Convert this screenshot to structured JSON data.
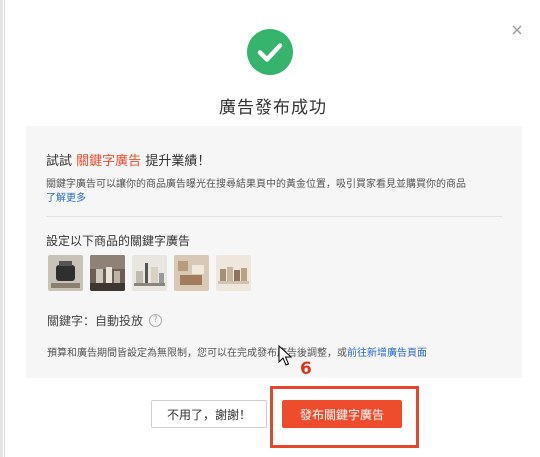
{
  "dialog": {
    "title": "廣告發布成功",
    "close_icon": "close-icon",
    "status_icon": "check-circle-icon",
    "colors": {
      "accent": "#ee4d2d",
      "success": "#36b36c",
      "link": "#2a6bd1"
    }
  },
  "promo": {
    "prefix": "試試",
    "highlight": "關鍵字廣告",
    "suffix": "提升業績！",
    "description": "關鍵字廣告可以讓你的商品廣告曝光在搜尋結果頁中的黃金位置，吸引買家看見並購買你的商品",
    "learn_more": "了解更多"
  },
  "products": {
    "label": "設定以下商品的關鍵字廣告",
    "thumbnails": [
      "product-1",
      "product-2",
      "product-3",
      "product-4",
      "product-5"
    ]
  },
  "keyword": {
    "label": "關鍵字：自動投放",
    "help_icon": "?"
  },
  "note": {
    "text": "預算和廣告期間皆設定為無限制，您可以在完成發布廣告後調整，或",
    "link": "前往新增廣告頁面"
  },
  "annotation": {
    "step_number": "6"
  },
  "actions": {
    "cancel_label": "不用了，謝謝！",
    "publish_label": "發布關鍵字廣告"
  }
}
